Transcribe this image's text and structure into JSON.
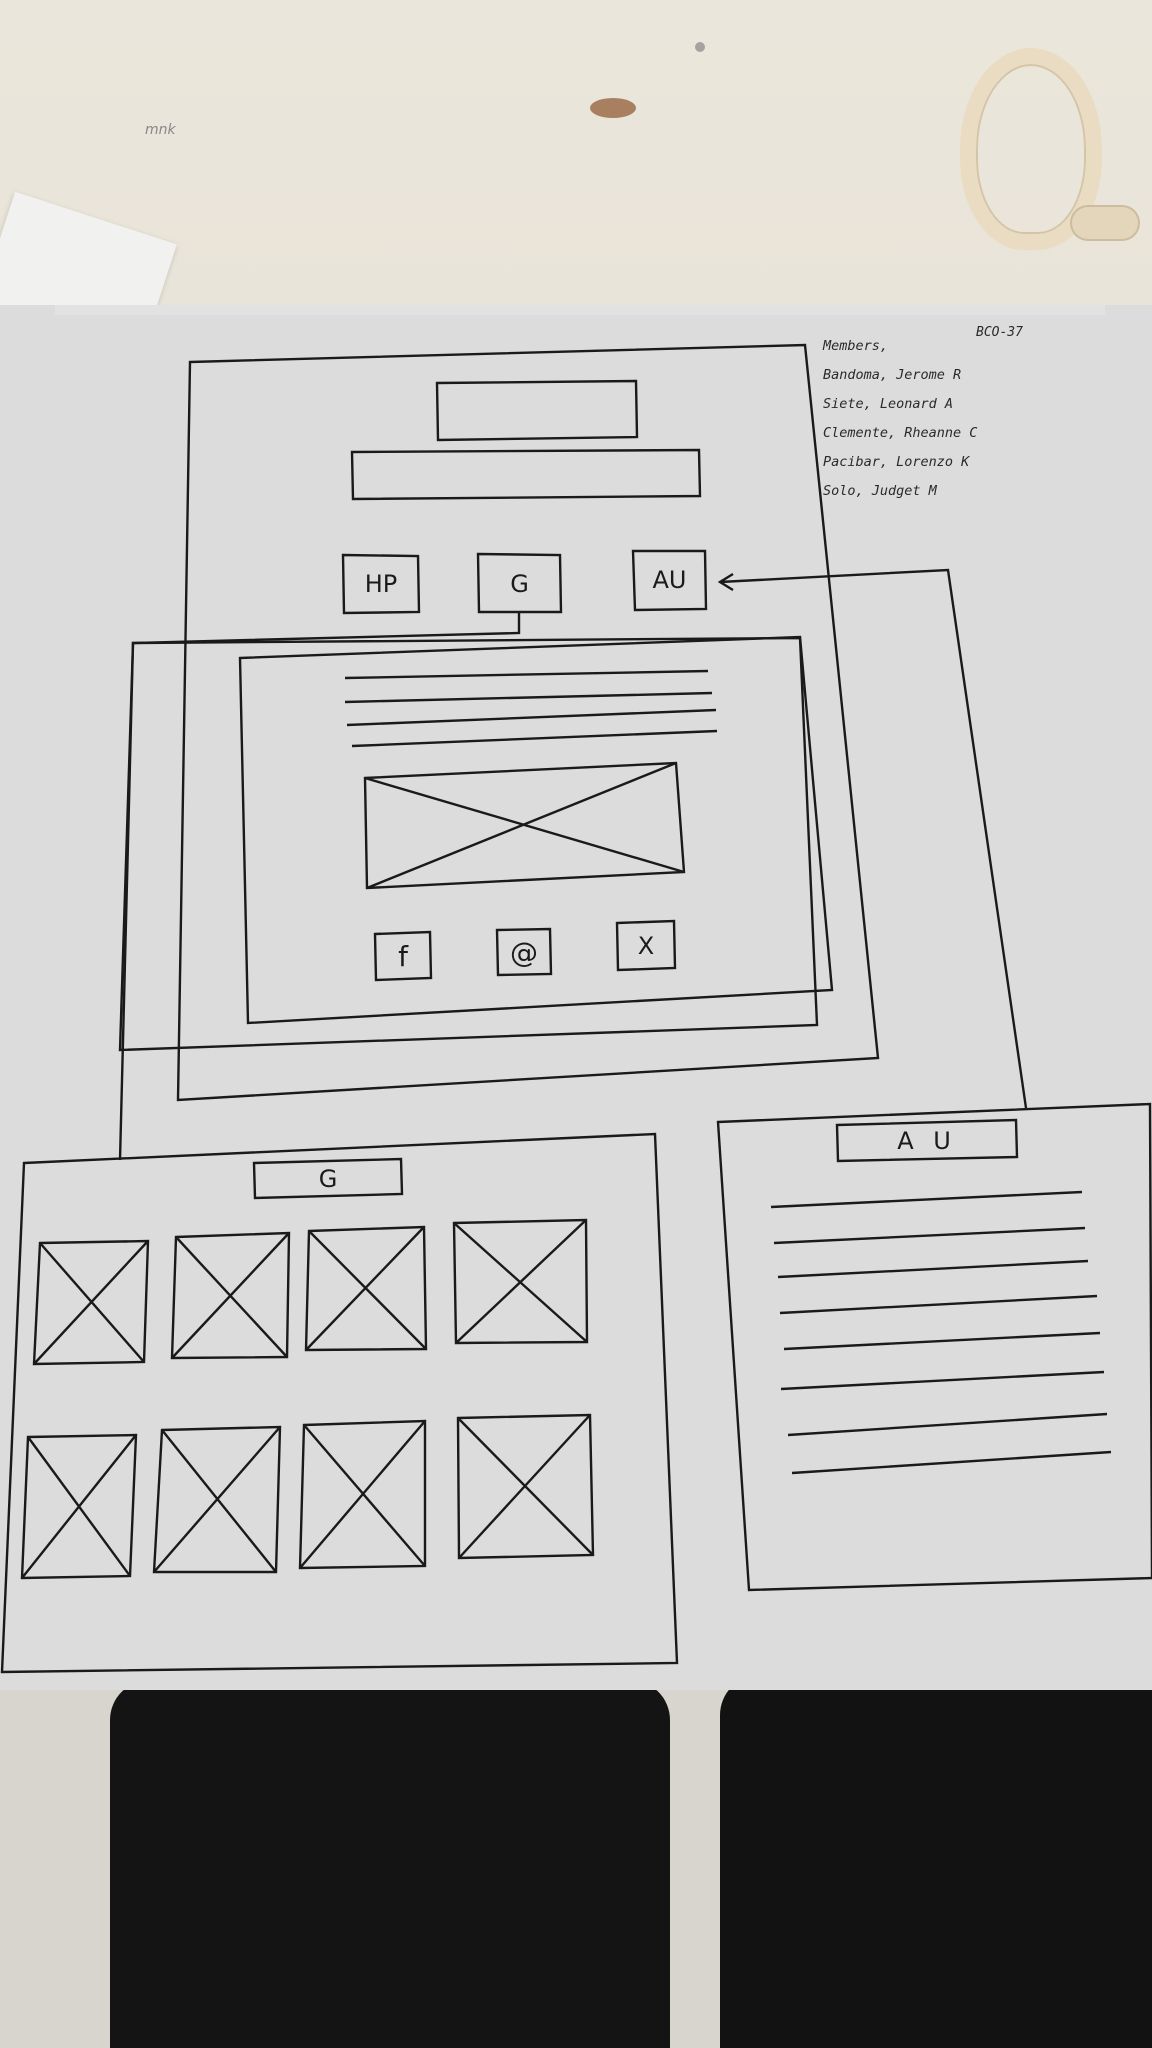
{
  "sheet": {
    "corner_code": "BCO-37",
    "names_header": "Members,",
    "names": [
      "Bandoma, Jerome R",
      "Siete, Leonard A",
      "Clemente, Rheanne C",
      "Pacibar, Lorenzo K",
      "Solo, Judget M"
    ],
    "desk_scribble": "mnk"
  },
  "main_page": {
    "nav": {
      "home_label": "HP",
      "gallery_label": "G",
      "about_label": "AU"
    },
    "social": {
      "facebook_label": "f",
      "email_label": "@",
      "twitter_label": "X"
    }
  },
  "gallery_page": {
    "title": "G"
  },
  "about_page": {
    "title": "A U"
  },
  "colors": {
    "ink": "#1a1a1a",
    "paper": "#dcdcdc",
    "desk": "#e7e2d7"
  }
}
